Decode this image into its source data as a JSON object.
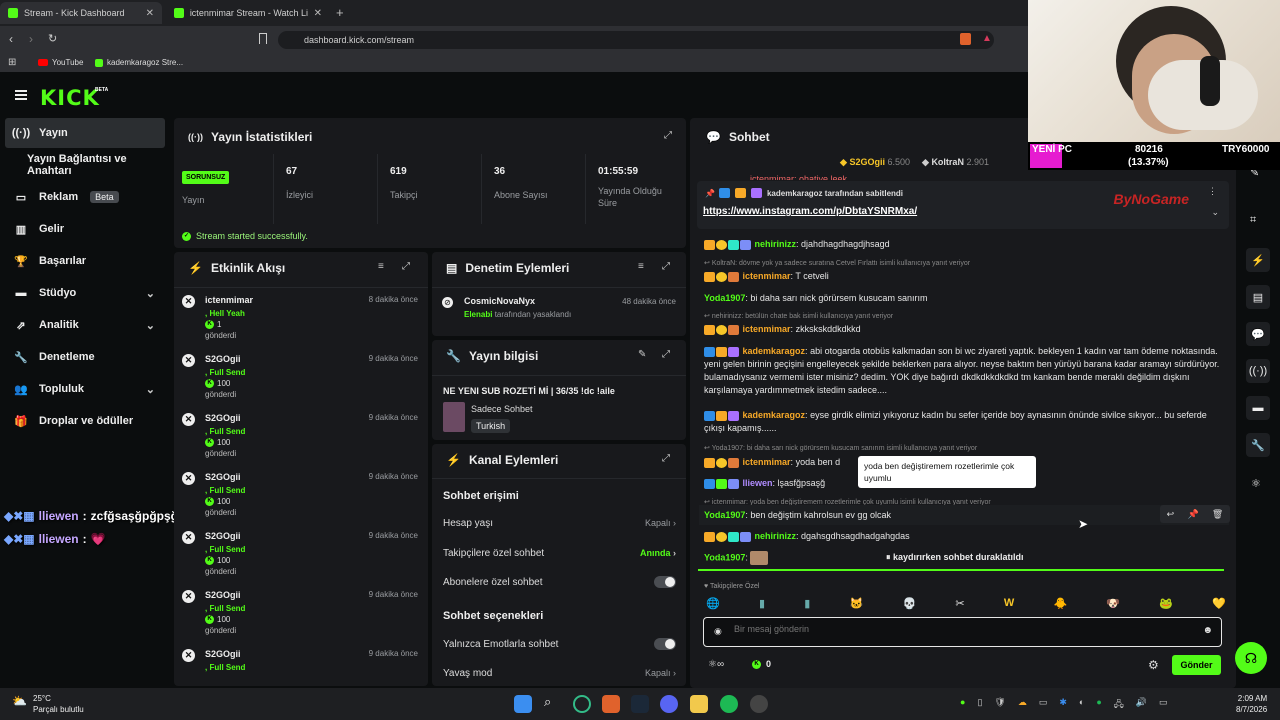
{
  "browser": {
    "tabs": [
      {
        "title": "Stream - Kick Dashboard",
        "close": "✕"
      },
      {
        "title": "ictenmimar Stream - Watch Live on K",
        "close": "✕"
      }
    ],
    "new_tab": "+",
    "url": "dashboard.kick.com/stream",
    "bookmarks": [
      "YouTube",
      "kademkaragoz Stre..."
    ]
  },
  "header": {
    "logo": "KICK",
    "beta": "BETA"
  },
  "sidebar": {
    "items": [
      {
        "label": "Yayın",
        "icon": "broadcast-icon"
      },
      {
        "label": "Yayın Bağlantısı ve Anahtarı"
      },
      {
        "label": "Reklam",
        "badge": "Beta",
        "icon": "ad-icon"
      },
      {
        "label": "Gelir",
        "icon": "chart-icon"
      },
      {
        "label": "Başarılar",
        "icon": "trophy-icon"
      },
      {
        "label": "Stüdyo",
        "icon": "studio-icon",
        "chevron": "⌄"
      },
      {
        "label": "Analitik",
        "icon": "analytics-icon",
        "chevron": "⌄"
      },
      {
        "label": "Denetleme",
        "icon": "wrench-icon"
      },
      {
        "label": "Topluluk",
        "icon": "community-icon",
        "chevron": "⌄"
      },
      {
        "label": "Droplar ve ödüller",
        "icon": "gift-icon"
      }
    ]
  },
  "stats": {
    "title": "Yayın İstatistikleri",
    "items": [
      {
        "value": "SORUNSUZ",
        "label": "Yayın"
      },
      {
        "value": "67",
        "label": "İzleyici"
      },
      {
        "value": "619",
        "label": "Takipçi"
      },
      {
        "value": "36",
        "label": "Abone Sayısı"
      },
      {
        "value": "01:55:59",
        "label": "Yayında Olduğu Süre"
      }
    ],
    "status": "Stream started successfully."
  },
  "activity": {
    "title": "Etkinlik Akışı",
    "events": [
      {
        "name": "ictenmimar",
        "time": "8 dakika önce",
        "sub": ", Hell Yeah",
        "count": "1",
        "gift": "gönderdi"
      },
      {
        "name": "S2GOgii",
        "time": "9 dakika önce",
        "sub": ", Full Send",
        "count": "100",
        "gift": "gönderdi"
      },
      {
        "name": "S2GOgii",
        "time": "9 dakika önce",
        "sub": ", Full Send",
        "count": "100",
        "gift": "gönderdi"
      },
      {
        "name": "S2GOgii",
        "time": "9 dakika önce",
        "sub": ", Full Send",
        "count": "100",
        "gift": "gönderdi"
      },
      {
        "name": "S2GOgii",
        "time": "9 dakika önce",
        "sub": ", Full Send",
        "count": "100",
        "gift": "gönderdi"
      },
      {
        "name": "S2GOgii",
        "time": "9 dakika önce",
        "sub": ", Full Send",
        "count": "100",
        "gift": "gönderdi"
      },
      {
        "name": "S2GOgii",
        "time": "9 dakika önce",
        "sub": ", Full Send",
        "count": "",
        "gift": ""
      }
    ]
  },
  "moderation": {
    "title": "Denetim Eylemleri",
    "item": {
      "name": "CosmicNovaNyx",
      "time": "48 dakika önce",
      "by": "Elenabi",
      "rest": "tarafından yasaklandı"
    }
  },
  "info": {
    "title": "Yayın bilgisi",
    "stream_title": "NE YENI SUB ROZETİ Mİ | 36/35 !dc !aile",
    "category": "Sadece Sohbet",
    "language": "Turkish"
  },
  "channel": {
    "title": "Kanal Eylemleri",
    "section1": "Sohbet erişimi",
    "rows": [
      {
        "label": "Hesap yaşı",
        "value": "Kapalı"
      },
      {
        "label": "Takipçilere özel sohbet",
        "value": "Anında"
      },
      {
        "label": "Abonelere özel sohbet",
        "value": ""
      }
    ],
    "section2": "Sohbet seçenekleri",
    "rows2": [
      {
        "label": "Yalnızca Emotlarla sohbet",
        "value": ""
      },
      {
        "label": "Yavaş mod",
        "value": "Kapalı"
      }
    ]
  },
  "chat": {
    "title": "Sohbet",
    "top_gifters": [
      {
        "name": "S2GOgii",
        "amount": "6.500"
      },
      {
        "name": "KoltraN",
        "amount": "2.901"
      }
    ],
    "cutoff_top": "ictenmimar: ohatiye leek",
    "pinned": {
      "by": "kademkaragoz tarafından sabitlendi",
      "link": "https://www.instagram.com/p/DbtaYSNRMxa/"
    },
    "messages": [
      {
        "user": "nehirinizz",
        "color": "#53fc18",
        "text": "djahdhagdhagdjhsagd"
      },
      {
        "reply": "KoltraN: dövme yok ya sadece suratına Cetvel Fırlattı isimli kullanıcıya yanıt veriyor"
      },
      {
        "user": "ictenmimar",
        "color": "#f7a928",
        "text": "T cetveli"
      },
      {
        "user": "Yoda1907",
        "color": "#53fc18",
        "text": "bi daha sarı nick görürsem kusucam sanırım"
      },
      {
        "reply": "nehirinizz: betülün chate bak isimli kullanıcıya yanıt veriyor"
      },
      {
        "user": "ictenmimar",
        "color": "#f7a928",
        "text": "zkksksk​ddkdkkd"
      },
      {
        "user": "kademkaragoz",
        "color": "#f7a928",
        "text": "abi otogarda otobüs kalkmadan son bi wc ziyareti yaptık. bekleyen 1 kadın var tam ödeme noktasında. yeni gelen birinin geçişini engelleyecek şekilde beklerken para alıyor. neyse baktım ben yürüyü barana kadar aramayı sürdürüyor. bulamadıysanız vermemi ister misiniz? dedim. YOK diye bağırdı dkdkdkkdkdkd tm kankam bende meraklı değildim dışkını karşılamaya yardımmetmek istedim sadece...."
      },
      {
        "user": "kademkaragoz",
        "color": "#f7a928",
        "text": "eyse girdik elimizi yıkıyoruz kadın bu sefer içeride boy aynasının önünde sivilce sıkıyor... bu seferde çıkışı kapamış......"
      },
      {
        "reply": "Yoda1907: bi daha sarı nick görürsem kusucam sanırım isimli kullanıcıya yanıt veriyor"
      },
      {
        "user": "ictenmimar",
        "color": "#f7a928",
        "text": "yoda ben d"
      },
      {
        "user": "lliewen",
        "color": "#b08cff",
        "text": "lşasfğpsaşğ"
      },
      {
        "reply": "ictenmimar: yoda ben değiştiremem rozetlerimle çok uyumlu isimli kullanıcıya yanıt veriyor"
      },
      {
        "user": "Yoda1907",
        "color": "#53fc18",
        "text": "ben değiştim kahrolsun ev gg olcak"
      },
      {
        "user": "nehirinizz",
        "color": "#53fc18",
        "text": "dgahsgdhsagdhadgahgdas"
      },
      {
        "user": "Yoda1907",
        "color": "#53fc18",
        "text": ""
      }
    ],
    "tooltip": "yoda ben değiştiremem rozetlerimle çok uyumlu",
    "paused": "kaydırırken sohbet duraklatıldı",
    "followers_only": "Takipçilere Özel",
    "input_placeholder": "Bir mesaj gönderin",
    "points": "0",
    "send": "Gönder"
  },
  "overlay": {
    "chat_lines": [
      {
        "user": "lliewen",
        "text": "zcfğsaşğpğpşğpasfpfsaşğpsafşğafs"
      },
      {
        "user": "lliewen",
        "text": "💗"
      }
    ],
    "label1": "YENİ PC",
    "label2": "80216",
    "label3": "TRY60000",
    "percent": "(13.37%)",
    "brand": "ByNoGame"
  },
  "taskbar": {
    "weather_temp": "25°C",
    "weather_desc": "Parçalı bulutlu",
    "time": "2:09 AM",
    "date": "8/7/2026"
  }
}
